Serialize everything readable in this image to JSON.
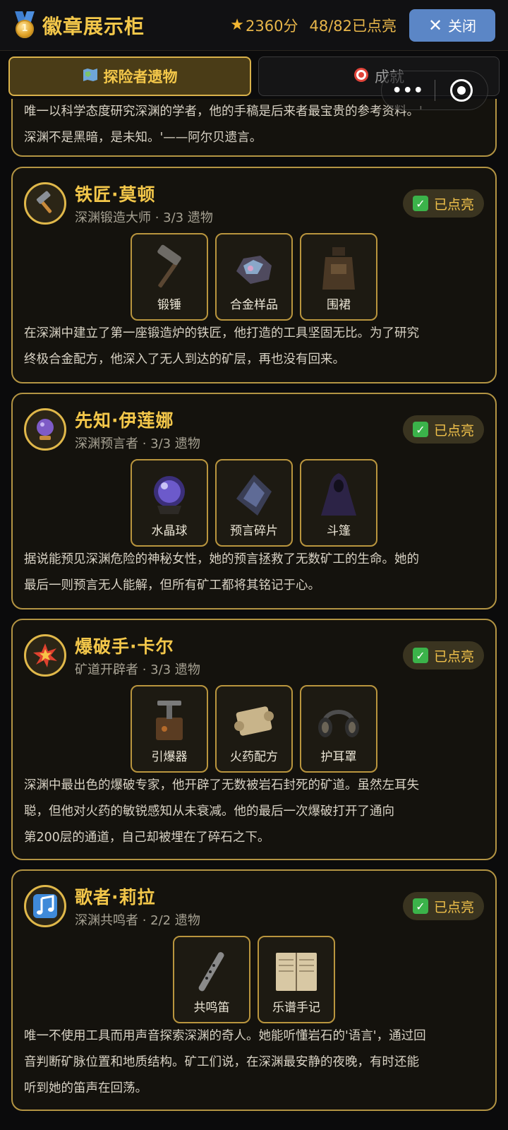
{
  "header": {
    "title": "徽章展示柜",
    "score": "2360分",
    "lit_count": "48/82已点亮",
    "close_label": "关闭"
  },
  "tabs": [
    {
      "label": "探险者遗物",
      "icon": "map-icon",
      "active": true
    },
    {
      "label": "成就",
      "icon": "target-icon",
      "active": false
    }
  ],
  "capsule": {
    "menu": "•••",
    "icon": "record-icon"
  },
  "partial_card": {
    "desc_lines": [
      "唯一以科学态度研究深渊的学者，他的手稿是后来者最宝贵的参考资料。'",
      "深渊不是黑暗，是未知。'——阿尔贝遗言。"
    ]
  },
  "cards": [
    {
      "name": "铁匠·莫顿",
      "subtitle": "深渊锻造大师 · 3/3 遗物",
      "avatar_icon": "hammer-icon",
      "badge": "已点亮",
      "relics": [
        "锻锤",
        "合金样品",
        "围裙"
      ],
      "desc_lines": [
        "在深渊中建立了第一座锻造炉的铁匠，他打造的工具坚固无比。为了研究",
        "终极合金配方，他深入了无人到达的矿层，再也没有回来。"
      ]
    },
    {
      "name": "先知·伊莲娜",
      "subtitle": "深渊预言者 · 3/3 遗物",
      "avatar_icon": "crystal-ball-icon",
      "badge": "已点亮",
      "relics": [
        "水晶球",
        "预言碎片",
        "斗篷"
      ],
      "desc_lines": [
        "据说能预见深渊危险的神秘女性，她的预言拯救了无数矿工的生命。她的",
        "最后一则预言无人能解，但所有矿工都将其铭记于心。"
      ]
    },
    {
      "name": "爆破手·卡尔",
      "subtitle": "矿道开辟者 · 3/3 遗物",
      "avatar_icon": "explosion-icon",
      "badge": "已点亮",
      "relics": [
        "引爆器",
        "火药配方",
        "护耳罩"
      ],
      "desc_lines": [
        "深渊中最出色的爆破专家，他开辟了无数被岩石封死的矿道。虽然左耳失",
        "聪，但他对火药的敏锐感知从未衰减。他的最后一次爆破打开了通向",
        "第200层的通道，自己却被埋在了碎石之下。"
      ]
    },
    {
      "name": "歌者·莉拉",
      "subtitle": "深渊共鸣者 · 2/2 遗物",
      "avatar_icon": "music-note-icon",
      "badge": "已点亮",
      "relics": [
        "共鸣笛",
        "乐谱手记"
      ],
      "desc_lines": [
        "唯一不使用工具而用声音探索深渊的奇人。她能听懂岩石的'语言'，通过回",
        "音判断矿脉位置和地质结构。矿工们说，在深渊最安静的夜晚，有时还能",
        "听到她的笛声在回荡。"
      ]
    }
  ]
}
